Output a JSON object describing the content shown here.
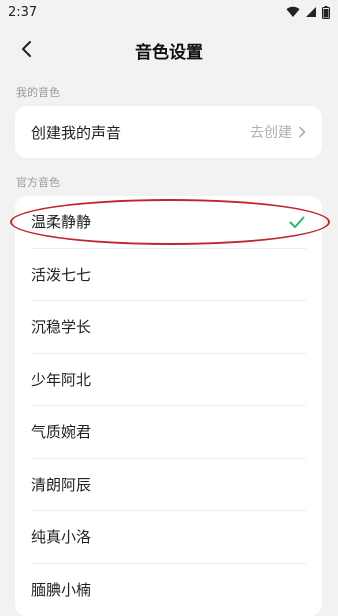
{
  "status_bar": {
    "time": "2:37"
  },
  "header": {
    "title": "音色设置"
  },
  "my_voice": {
    "section_label": "我的音色",
    "create_label": "创建我的声音",
    "create_action": "去创建"
  },
  "official": {
    "section_label": "官方音色",
    "voices": [
      {
        "name": "温柔静静",
        "selected": true
      },
      {
        "name": "活泼七七",
        "selected": false
      },
      {
        "name": "沉稳学长",
        "selected": false
      },
      {
        "name": "少年阿北",
        "selected": false
      },
      {
        "name": "气质婉君",
        "selected": false
      },
      {
        "name": "清朗阿辰",
        "selected": false
      },
      {
        "name": "纯真小洛",
        "selected": false
      },
      {
        "name": "腼腆小楠",
        "selected": false
      }
    ]
  },
  "colors": {
    "accent_check": "#2bb673",
    "annotation": "#c0272d"
  },
  "icons": [
    "wifi-icon",
    "signal-icon",
    "battery-icon",
    "back-arrow-icon",
    "chevron-right-icon",
    "checkmark-icon"
  ]
}
